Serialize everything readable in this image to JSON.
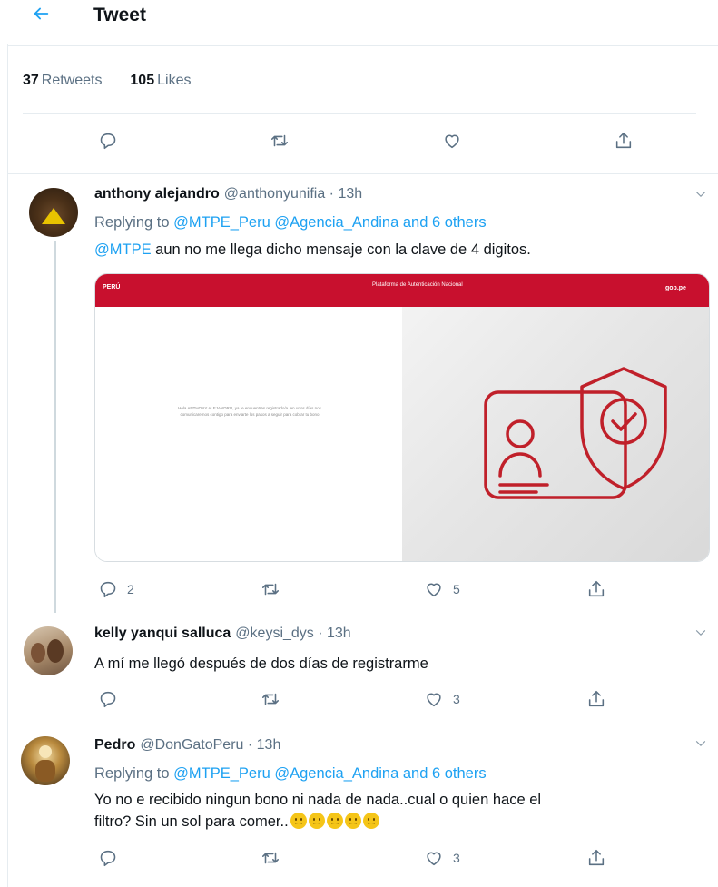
{
  "header": {
    "title": "Tweet"
  },
  "stats": {
    "retweets_count": "37",
    "retweets_label": "Retweets",
    "likes_count": "105",
    "likes_label": "Likes"
  },
  "replies": [
    {
      "name": "anthony alejandro",
      "handle_time": "@anthonyunifia · 13h",
      "replying_prefix": "Replying to",
      "replying_targets": "@MTPE_Peru @Agencia_Andina and 6 others",
      "mention": "@MTPE",
      "text": " aun no me llega dicho mensaje con la clave de 4 digitos.",
      "reply_count": "2",
      "retweet_count": "",
      "like_count": "5",
      "media": {
        "logo": "PERÚ",
        "center": "Plataforma de Autenticación Nacional",
        "gob": "gob.pe",
        "message": "Hola ANTHONY ALEJANDRO, ya te encuentras registrado/a. en unos días nos comunicaremos contigo para enviarte los pasos a seguir para cobrar tu bono"
      }
    },
    {
      "name": "kelly yanqui salluca",
      "handle_time": "@keysi_dys · 13h",
      "text": "A mí me llegó después de dos días de registrarme",
      "reply_count": "",
      "retweet_count": "",
      "like_count": "3"
    },
    {
      "name": "Pedro",
      "handle_time": "@DonGatoPeru · 13h",
      "replying_prefix": "Replying to",
      "replying_targets": "@MTPE_Peru @Agencia_Andina and 6 others",
      "text_line1": "Yo no e recibido ningun bono ni nada de nada..cual o quien hace el",
      "text_line2": "filtro? Sin un sol para comer..",
      "reply_count": "",
      "retweet_count": "",
      "like_count": "3"
    }
  ],
  "colors": {
    "accent": "#1da1f2",
    "secondary": "#5b7083",
    "divider": "#e6ecf0",
    "media_red": "#c8102e"
  }
}
